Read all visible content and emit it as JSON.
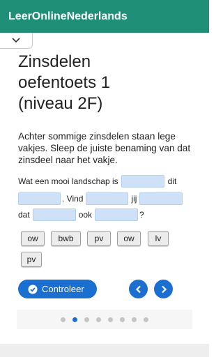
{
  "app": {
    "title": "LeerOnlineNederlands"
  },
  "header": {
    "collapse_icon": "chevron-down-icon"
  },
  "lesson": {
    "title_lines": [
      "Zinsdelen",
      "oefentoets 1",
      "(niveau 2F)"
    ],
    "instruction": "Achter sommige zinsdelen staan lege vakjes. Sleep de juiste benaming van dat zinsdeel naar het vakje."
  },
  "sentence": {
    "part1": "Wat een mooi landschap is",
    "part2": "dit",
    "part3": ". Vind",
    "part4": "jij",
    "part5": "dat",
    "part6": "ook",
    "part7": "?"
  },
  "options": [
    "ow",
    "bwb",
    "pv",
    "ow",
    "lv",
    "pv"
  ],
  "actions": {
    "check_label": "Controleer",
    "check_icon": "check-circle-icon",
    "prev_icon": "chevron-left-icon",
    "next_icon": "chevron-right-icon"
  },
  "pagination": {
    "total": 8,
    "current": 2
  },
  "colors": {
    "appbar": "#1f8f78",
    "accent": "#1b6fd1",
    "blank": "#cfe1f7"
  }
}
